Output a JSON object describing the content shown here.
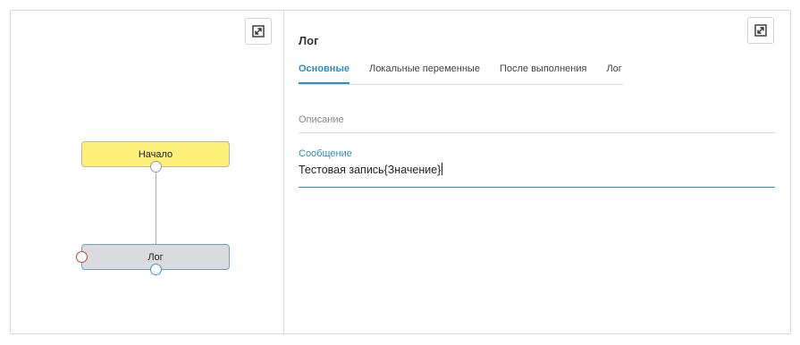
{
  "diagram": {
    "nodes": {
      "start": "Начало",
      "log": "Лог"
    }
  },
  "panel": {
    "title": "Лог",
    "tabs": [
      {
        "label": "Основные",
        "active": true
      },
      {
        "label": "Локальные переменные"
      },
      {
        "label": "После выполнения"
      },
      {
        "label": "Лог"
      }
    ],
    "fields": {
      "description": {
        "placeholder": "Описание",
        "value": ""
      },
      "message": {
        "label": "Сообщение",
        "value": "Тестовая запись{Значение}"
      }
    }
  },
  "icons": {
    "expand": "expand-icon"
  },
  "colors": {
    "accent": "#2f8fc4",
    "start_node": "#fdf07a",
    "log_node": "#d9dbdf",
    "error_port": "#d23b3b"
  }
}
